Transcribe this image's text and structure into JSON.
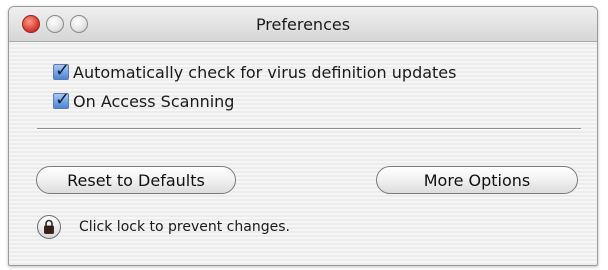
{
  "window": {
    "title": "Preferences"
  },
  "options": [
    {
      "label": "Automatically check for virus definition updates",
      "checked": true
    },
    {
      "label": "On Access Scanning",
      "checked": true
    }
  ],
  "buttons": {
    "reset_label": "Reset to Defaults",
    "more_label": "More Options"
  },
  "lock": {
    "icon": "lock-icon",
    "text": "Click lock to prevent changes."
  },
  "colors": {
    "close_button": "#e0453a",
    "checkbox_accent": "#4b86d8"
  }
}
